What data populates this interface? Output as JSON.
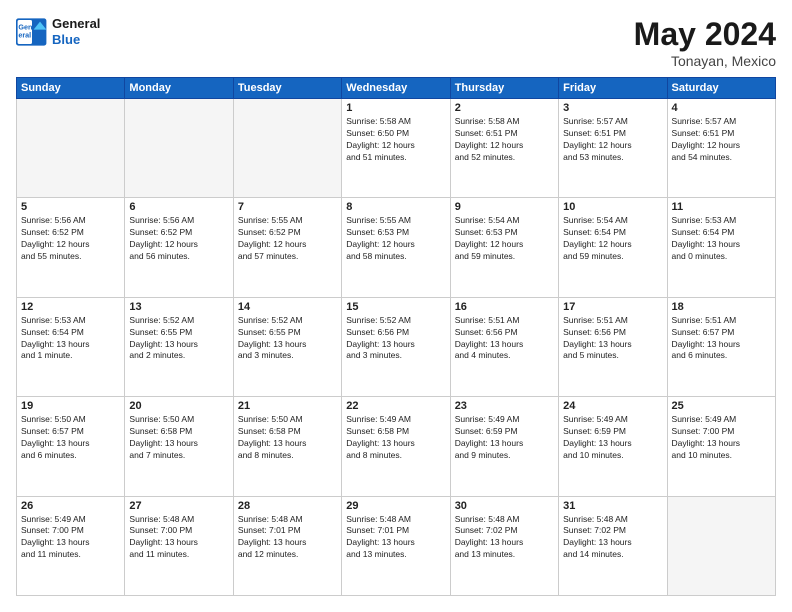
{
  "header": {
    "logo_line1": "General",
    "logo_line2": "Blue",
    "month_title": "May 2024",
    "location": "Tonayan, Mexico"
  },
  "weekdays": [
    "Sunday",
    "Monday",
    "Tuesday",
    "Wednesday",
    "Thursday",
    "Friday",
    "Saturday"
  ],
  "weeks": [
    [
      {
        "day": "",
        "info": ""
      },
      {
        "day": "",
        "info": ""
      },
      {
        "day": "",
        "info": ""
      },
      {
        "day": "1",
        "info": "Sunrise: 5:58 AM\nSunset: 6:50 PM\nDaylight: 12 hours\nand 51 minutes."
      },
      {
        "day": "2",
        "info": "Sunrise: 5:58 AM\nSunset: 6:51 PM\nDaylight: 12 hours\nand 52 minutes."
      },
      {
        "day": "3",
        "info": "Sunrise: 5:57 AM\nSunset: 6:51 PM\nDaylight: 12 hours\nand 53 minutes."
      },
      {
        "day": "4",
        "info": "Sunrise: 5:57 AM\nSunset: 6:51 PM\nDaylight: 12 hours\nand 54 minutes."
      }
    ],
    [
      {
        "day": "5",
        "info": "Sunrise: 5:56 AM\nSunset: 6:52 PM\nDaylight: 12 hours\nand 55 minutes."
      },
      {
        "day": "6",
        "info": "Sunrise: 5:56 AM\nSunset: 6:52 PM\nDaylight: 12 hours\nand 56 minutes."
      },
      {
        "day": "7",
        "info": "Sunrise: 5:55 AM\nSunset: 6:52 PM\nDaylight: 12 hours\nand 57 minutes."
      },
      {
        "day": "8",
        "info": "Sunrise: 5:55 AM\nSunset: 6:53 PM\nDaylight: 12 hours\nand 58 minutes."
      },
      {
        "day": "9",
        "info": "Sunrise: 5:54 AM\nSunset: 6:53 PM\nDaylight: 12 hours\nand 59 minutes."
      },
      {
        "day": "10",
        "info": "Sunrise: 5:54 AM\nSunset: 6:54 PM\nDaylight: 12 hours\nand 59 minutes."
      },
      {
        "day": "11",
        "info": "Sunrise: 5:53 AM\nSunset: 6:54 PM\nDaylight: 13 hours\nand 0 minutes."
      }
    ],
    [
      {
        "day": "12",
        "info": "Sunrise: 5:53 AM\nSunset: 6:54 PM\nDaylight: 13 hours\nand 1 minute."
      },
      {
        "day": "13",
        "info": "Sunrise: 5:52 AM\nSunset: 6:55 PM\nDaylight: 13 hours\nand 2 minutes."
      },
      {
        "day": "14",
        "info": "Sunrise: 5:52 AM\nSunset: 6:55 PM\nDaylight: 13 hours\nand 3 minutes."
      },
      {
        "day": "15",
        "info": "Sunrise: 5:52 AM\nSunset: 6:56 PM\nDaylight: 13 hours\nand 3 minutes."
      },
      {
        "day": "16",
        "info": "Sunrise: 5:51 AM\nSunset: 6:56 PM\nDaylight: 13 hours\nand 4 minutes."
      },
      {
        "day": "17",
        "info": "Sunrise: 5:51 AM\nSunset: 6:56 PM\nDaylight: 13 hours\nand 5 minutes."
      },
      {
        "day": "18",
        "info": "Sunrise: 5:51 AM\nSunset: 6:57 PM\nDaylight: 13 hours\nand 6 minutes."
      }
    ],
    [
      {
        "day": "19",
        "info": "Sunrise: 5:50 AM\nSunset: 6:57 PM\nDaylight: 13 hours\nand 6 minutes."
      },
      {
        "day": "20",
        "info": "Sunrise: 5:50 AM\nSunset: 6:58 PM\nDaylight: 13 hours\nand 7 minutes."
      },
      {
        "day": "21",
        "info": "Sunrise: 5:50 AM\nSunset: 6:58 PM\nDaylight: 13 hours\nand 8 minutes."
      },
      {
        "day": "22",
        "info": "Sunrise: 5:49 AM\nSunset: 6:58 PM\nDaylight: 13 hours\nand 8 minutes."
      },
      {
        "day": "23",
        "info": "Sunrise: 5:49 AM\nSunset: 6:59 PM\nDaylight: 13 hours\nand 9 minutes."
      },
      {
        "day": "24",
        "info": "Sunrise: 5:49 AM\nSunset: 6:59 PM\nDaylight: 13 hours\nand 10 minutes."
      },
      {
        "day": "25",
        "info": "Sunrise: 5:49 AM\nSunset: 7:00 PM\nDaylight: 13 hours\nand 10 minutes."
      }
    ],
    [
      {
        "day": "26",
        "info": "Sunrise: 5:49 AM\nSunset: 7:00 PM\nDaylight: 13 hours\nand 11 minutes."
      },
      {
        "day": "27",
        "info": "Sunrise: 5:48 AM\nSunset: 7:00 PM\nDaylight: 13 hours\nand 11 minutes."
      },
      {
        "day": "28",
        "info": "Sunrise: 5:48 AM\nSunset: 7:01 PM\nDaylight: 13 hours\nand 12 minutes."
      },
      {
        "day": "29",
        "info": "Sunrise: 5:48 AM\nSunset: 7:01 PM\nDaylight: 13 hours\nand 13 minutes."
      },
      {
        "day": "30",
        "info": "Sunrise: 5:48 AM\nSunset: 7:02 PM\nDaylight: 13 hours\nand 13 minutes."
      },
      {
        "day": "31",
        "info": "Sunrise: 5:48 AM\nSunset: 7:02 PM\nDaylight: 13 hours\nand 14 minutes."
      },
      {
        "day": "",
        "info": ""
      }
    ]
  ]
}
